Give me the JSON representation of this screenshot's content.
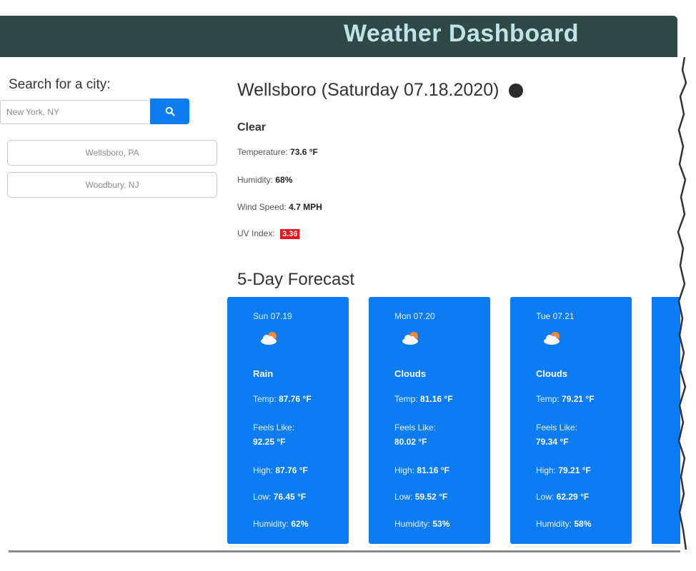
{
  "header": {
    "title": "Weather Dashboard"
  },
  "sidebar": {
    "search_label": "Search for a city:",
    "search_placeholder": "New York, NY",
    "history": [
      "Wellsboro, PA",
      "Woodbury, NJ"
    ]
  },
  "current": {
    "title": "Wellsboro (Saturday 07.18.2020)",
    "condition": "Clear",
    "temperature_label": "Temperature:",
    "temperature_value": "73.6 °F",
    "humidity_label": "Humidity:",
    "humidity_value": "68%",
    "wind_label": "Wind Speed:",
    "wind_value": "4.7 MPH",
    "uv_label": "UV Index:",
    "uv_value": "3.36",
    "uv_color": "#e8141b"
  },
  "forecast": {
    "title": "5-Day Forecast",
    "card_color": "#0d7cf2",
    "icon": "cloudy-sun-icon",
    "cards": [
      {
        "date": "Sun 07.19",
        "condition": "Rain",
        "temp_label": "Temp:",
        "temp": "87.76 °F",
        "feels_label": "Feels Like:",
        "feels": "92.25 °F",
        "high_label": "High:",
        "high": "87.76 °F",
        "low_label": "Low:",
        "low": "76.45 °F",
        "humidity_label": "Humidity:",
        "humidity": "62%"
      },
      {
        "date": "Mon 07.20",
        "condition": "Clouds",
        "temp_label": "Temp:",
        "temp": "81.16 °F",
        "feels_label": "Feels Like:",
        "feels": "80.02 °F",
        "high_label": "High:",
        "high": "81.16 °F",
        "low_label": "Low:",
        "low": "59.52 °F",
        "humidity_label": "Humidity:",
        "humidity": "53%"
      },
      {
        "date": "Tue 07.21",
        "condition": "Clouds",
        "temp_label": "Temp:",
        "temp": "79.21 °F",
        "feels_label": "Feels Like:",
        "feels": "79.34 °F",
        "high_label": "High:",
        "high": "79.21 °F",
        "low_label": "Low:",
        "low": "62.29 °F",
        "humidity_label": "Humidity:",
        "humidity": "58%"
      }
    ]
  },
  "colors": {
    "header_bg": "#2f4a46",
    "header_text": "#bfe3e8",
    "accent": "#0d7cf2"
  }
}
